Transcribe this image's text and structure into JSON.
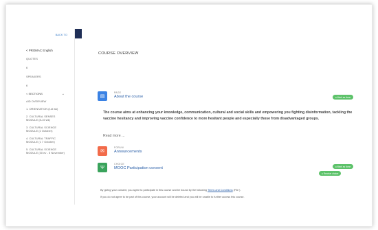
{
  "sidebar": {
    "top_link": "BACK TO",
    "course_label": "< PROMAC English",
    "items": [
      "QUOTES",
      "6",
      "SPEAKERS",
      "6"
    ],
    "sections_label": "< SECTIONS",
    "sections": [
      "AID OVERVIEW",
      "1. ORIENTATION (1st wk)",
      "2. CULTURAL SENSES MODULE (8-15 wk)",
      "3. CULTURAL SCIENCE MODULE (2 October)",
      "4. CULTURAL TRAFFIC MODULE (1 7 October)",
      "5. CULTURAL SCIENCE MODULE (30 ev - 5 November)"
    ]
  },
  "main": {
    "course_overview": "COURSE OVERVIEW",
    "activities": [
      {
        "type": "PAGE",
        "title": "About the course",
        "badge": "● Mark as done",
        "icon": "page-icon",
        "color": "#3a82e4"
      },
      {
        "type": "FORUM",
        "title": "Announcements",
        "icon": "forum-icon",
        "color": "#f26b4a"
      },
      {
        "type": "CHOICE",
        "title": "MOOC Participation consent",
        "badge": "● Mark as done",
        "badge2": "● Receive choice",
        "icon": "choice-icon",
        "color": "#3aa35c"
      }
    ],
    "description": "The course aims at enhancing your knowledge, communication, cultural and social skills and empowering you fighting disinformation, tackling the vaccine hesitancy and improving vaccine confidence to more hesitant people and especially those from disadvantaged groups.",
    "read_more": "Read more ...",
    "consent_line1_pre": "By giving your consent, you agree to participate in this course and be bound by the following",
    "consent_link": "Terms and Conditions",
    "consent_line1_post": "(File ).",
    "consent_line2": "If you do not agree to be part of this course, your account will be deleted and you will be unable to further access this course."
  },
  "colors": {
    "navy": "#1f2e56",
    "link": "#2a5fa8",
    "done_badge": "#5dc26a"
  }
}
